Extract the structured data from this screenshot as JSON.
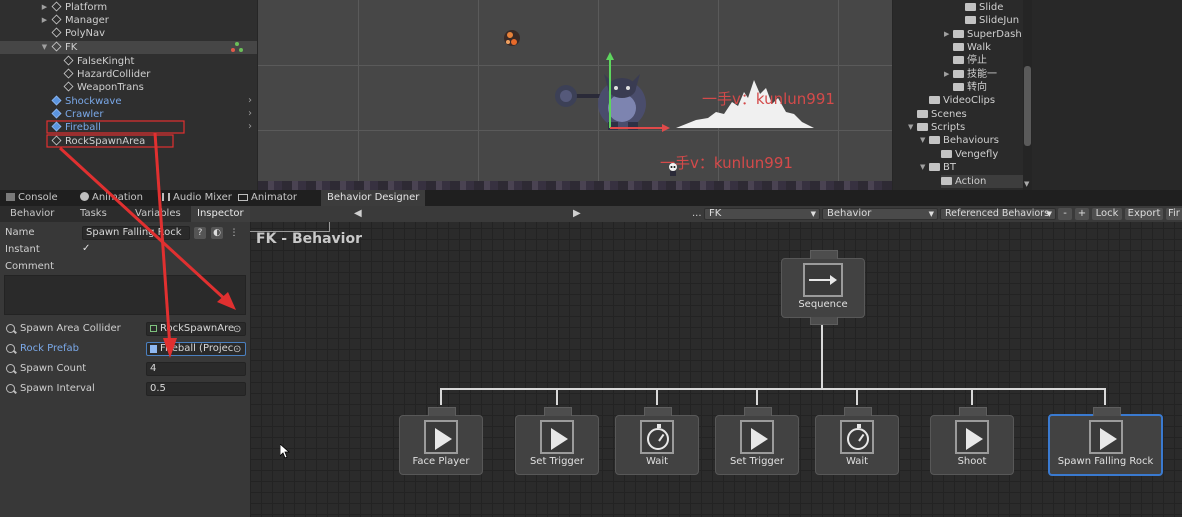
{
  "hierarchy": {
    "items": [
      {
        "label": "Platform",
        "blue": false
      },
      {
        "label": "Manager",
        "blue": false
      },
      {
        "label": "PolyNav",
        "blue": false
      },
      {
        "label": "FK",
        "blue": false
      },
      {
        "label": "FalseKinght",
        "blue": false
      },
      {
        "label": "HazardCollider",
        "blue": false
      },
      {
        "label": "WeaponTrans",
        "blue": false
      },
      {
        "label": "Shockwave",
        "blue": true
      },
      {
        "label": "Crawler",
        "blue": true
      },
      {
        "label": "Fireball",
        "blue": true
      },
      {
        "label": "RockSpawnArea",
        "blue": false
      }
    ]
  },
  "scene": {
    "watermark1": "一手v：kunlun991",
    "watermark2": "一手v：kunlun991"
  },
  "project": {
    "items": [
      {
        "label": "Slide"
      },
      {
        "label": "SlideJun"
      },
      {
        "label": "SuperDash"
      },
      {
        "label": "Walk"
      },
      {
        "label": "停止"
      },
      {
        "label": "技能一"
      },
      {
        "label": "转向"
      },
      {
        "label": "VideoClips"
      },
      {
        "label": "Scenes"
      },
      {
        "label": "Scripts"
      },
      {
        "label": "Behaviours"
      },
      {
        "label": "Vengefly"
      },
      {
        "label": "BT"
      },
      {
        "label": "Action"
      }
    ]
  },
  "tabs": {
    "console": "Console",
    "animation": "Animation",
    "audio_mixer": "Audio Mixer",
    "animator": "Animator",
    "behavior_designer": "Behavior Designer"
  },
  "inspector": {
    "tabs": [
      "Behavior",
      "Tasks",
      "Variables",
      "Inspector"
    ],
    "name_label": "Name",
    "name_value": "Spawn Falling Rock",
    "instant_label": "Instant",
    "instant_check": "✓",
    "comment_label": "Comment",
    "fields": [
      {
        "label": "Spawn Area Collider",
        "value": "RockSpawnAre",
        "blue": false
      },
      {
        "label": "Rock Prefab",
        "value": "Fireball (Projec",
        "blue": true
      },
      {
        "label": "Spawn Count",
        "value": "4",
        "blue": false
      },
      {
        "label": "Spawn Interval",
        "value": "0.5",
        "blue": false
      }
    ]
  },
  "graph": {
    "toolbar": {
      "prev": "◀",
      "next": "▶",
      "dots": "...",
      "object": "FK",
      "behavior": "Behavior",
      "referenced": "Referenced Behaviors",
      "minus": "-",
      "plus": "+",
      "lock": "Lock",
      "export": "Export",
      "find": "Fir"
    },
    "title": "FK - Behavior",
    "root": {
      "label": "Sequence"
    },
    "children": [
      {
        "label": "Face Player",
        "icon": "play-icon"
      },
      {
        "label": "Set Trigger",
        "icon": "play-icon"
      },
      {
        "label": "Wait",
        "icon": "stopwatch-icon"
      },
      {
        "label": "Set Trigger",
        "icon": "play-icon"
      },
      {
        "label": "Wait",
        "icon": "stopwatch-icon"
      },
      {
        "label": "Shoot",
        "icon": "play-icon"
      },
      {
        "label": "Spawn Falling Rock",
        "icon": "play-icon"
      }
    ]
  },
  "colors": {
    "accent_blue": "#3a7ad0",
    "annotation_red": "#e03030",
    "prefab_blue": "#7aa8e8"
  }
}
